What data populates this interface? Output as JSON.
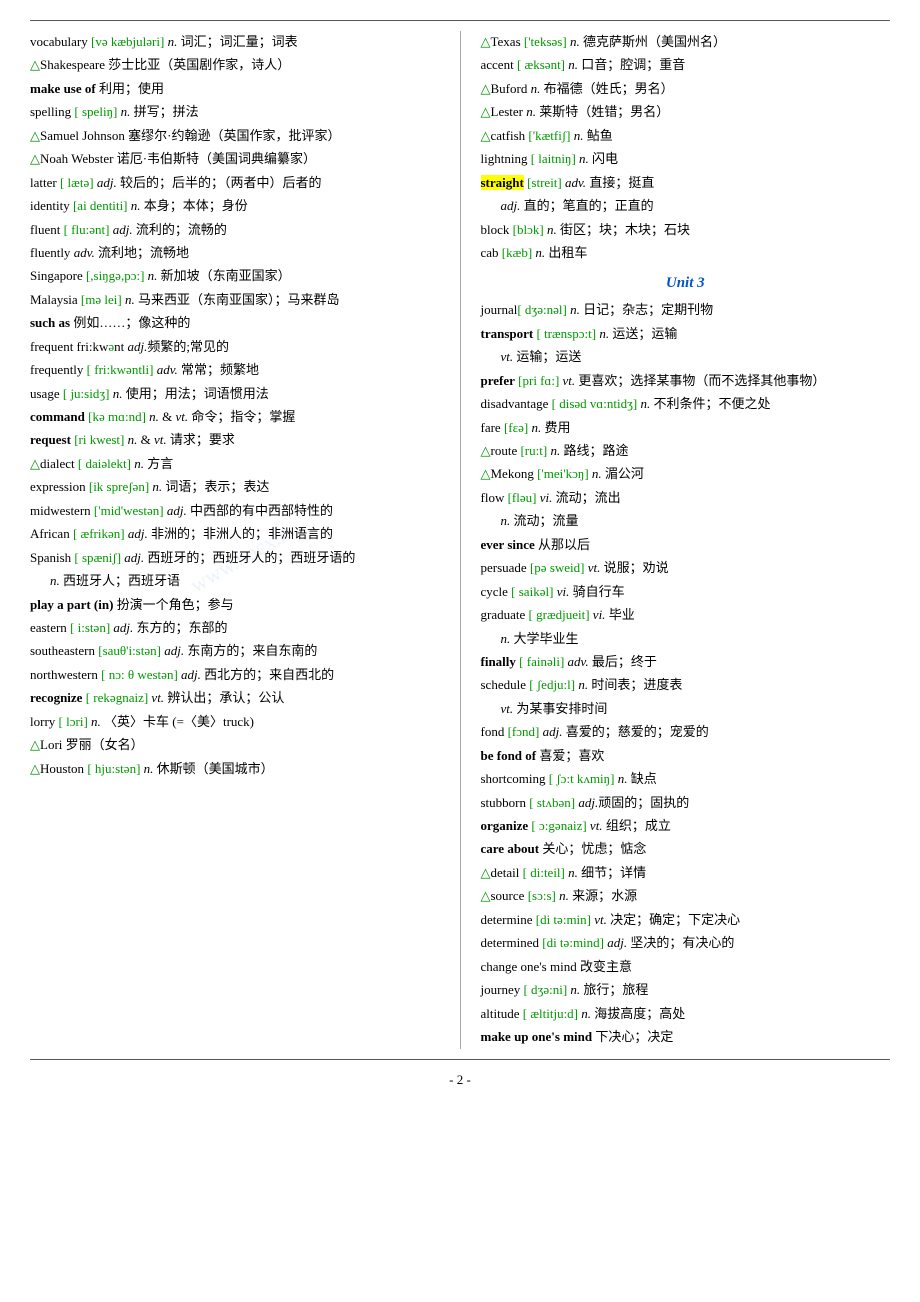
{
  "page": {
    "number": "- 2 -",
    "watermark": "www.bocx.r...",
    "divider_top": true,
    "divider_bottom": true
  },
  "left_col": [
    {
      "type": "entry",
      "text": "vocabulary [və  kæbjuləri]  <i>n.</i> 词汇；词汇量；词表",
      "indent": false
    },
    {
      "type": "entry",
      "text": "△Shakespeare 莎士比亚（英国剧作家，诗人）",
      "indent": false
    },
    {
      "type": "entry",
      "text": "<b>make use of</b> 利用；使用",
      "indent": false
    },
    {
      "type": "entry",
      "text": "spelling [  speli<span class='phonetic'>ŋ</span>]  <i>n.</i> 拼写；拼法",
      "indent": false
    },
    {
      "type": "entry",
      "text": "△Samuel Johnson 塞缪尔·约翰逊（英国作家，批评家）",
      "indent": false,
      "multiline": true
    },
    {
      "type": "entry",
      "text": "△Noah Webster 诺厄·韦伯斯特（美国词典编纂家）",
      "indent": false,
      "multiline": true
    },
    {
      "type": "entry",
      "text": "latter [  læt<span class='phonetic'>ə</span>]  <i>adj.</i> 较后的；后半的；（两者中）后者的",
      "indent": false,
      "multiline": true
    },
    {
      "type": "entry",
      "text": "identity [ai  denti<span class='phonetic'>t</span>i]  <i>n.</i> 本身；本体；身份",
      "indent": false,
      "multiline": true
    },
    {
      "type": "entry",
      "text": "fluent [  flu:<span class='phonetic'>ə</span>nt]  <i>adj.</i> 流利的；流畅的",
      "indent": false
    },
    {
      "type": "entry",
      "text": "fluently  <i>adv.</i> 流利地；流畅地",
      "indent": false
    },
    {
      "type": "entry",
      "text": "Singapore [,si<span class='phonetic'>ŋ</span>g<span class='phonetic'>ə</span>,p<span class='phonetic'>ɔ</span>:]  <i>n.</i> 新加坡（东南亚国家）",
      "indent": false,
      "multiline": true
    },
    {
      "type": "entry",
      "text": "Malaysia [m<span class='phonetic'>ə</span>  lei]  <i>n.</i> 马来西亚（东南亚国家）；马来群岛",
      "indent": false,
      "multiline": true
    },
    {
      "type": "entry",
      "text": "<b>such as</b> 例如……；像这种的",
      "indent": false
    },
    {
      "type": "entry",
      "text": "frequent   fri:kw<span class='phonetic'>ə</span>nt  <i>adj.</i>频繁的;常见的",
      "indent": false
    },
    {
      "type": "entry",
      "text": "frequently [  fri:kw<span class='phonetic'>ə</span>ntli]  <i>adv.</i> 常常；频繁地",
      "indent": false,
      "multiline": true
    },
    {
      "type": "entry",
      "text": "usage [  ju:si<span class='phonetic'>dʒ</span>]  <i>n.</i> 使用；用法；词语惯用法",
      "indent": false,
      "multiline": true
    },
    {
      "type": "entry",
      "text": "<b>command</b> [k<span class='phonetic'>ə</span>  m<span class='phonetic'>ɑ</span>:nd]  <i>n.</i> & <i>vt.</i> 命令；指令；掌握",
      "indent": false,
      "multiline": true
    },
    {
      "type": "entry",
      "text": "<b>request</b> [ri  kwest]  <i>n.</i> & <i>vt.</i> 请求；要求",
      "indent": false
    },
    {
      "type": "entry",
      "text": "△dialect [  dai<span class='phonetic'>ə</span>lekt]  <i>n.</i> 方言",
      "indent": false
    },
    {
      "type": "entry",
      "text": "expression [ik  spre<span class='phonetic'>ʃə</span>n]  <i>n.</i> 词语；表示；表达",
      "indent": false,
      "multiline": true
    },
    {
      "type": "entry",
      "text": "midwestern ['mid'west<span class='phonetic'>ə</span>n]   <i>adj.</i> 中西部的有中西部特性的",
      "indent": false,
      "multiline": true
    },
    {
      "type": "entry",
      "text": "African [  <span class='phonetic'>æ</span>frik<span class='phonetic'>ə</span>n]  <i>adj.</i> 非洲的；非洲人的；非洲语言的",
      "indent": false,
      "multiline": true
    },
    {
      "type": "entry",
      "text": "Spanish [  sp<span class='phonetic'>æ</span>ni<span class='phonetic'>ʃ</span>]  <i>adj.</i> 西班牙的；西班牙人的；西班牙语的",
      "indent": false,
      "multiline": true
    },
    {
      "type": "entry",
      "text": "         <i>n.</i> 西班牙人；西班牙语",
      "indent": true
    },
    {
      "type": "entry",
      "text": "<b>play a part (in)</b> 扮演一个角色；参与",
      "indent": false
    },
    {
      "type": "entry",
      "text": "eastern [  i:st<span class='phonetic'>ə</span>n]  <i>adj.</i> 东方的；东部的",
      "indent": false
    },
    {
      "type": "entry",
      "text": "southeastern [sauθ'i:st<span class='phonetic'>ə</span>n]  <i>adj.</i> 东南方的；来自东南的",
      "indent": false,
      "multiline": true
    },
    {
      "type": "entry",
      "text": "northwestern [  n<span class='phonetic'>ɔ</span>: θ  west<span class='phonetic'>ə</span>n]  <i>adj.</i> 西北方的；来自西北的",
      "indent": false,
      "multiline": true
    },
    {
      "type": "entry",
      "text": "<b>recognize</b> [  rek<span class='phonetic'>ə</span>gnaiz]  <i>vt.</i> 辨认出；承认；公认",
      "indent": false,
      "multiline": true
    },
    {
      "type": "entry",
      "text": "lorry [  l<span class='phonetic'>ɔ</span>ri]  <i>n.</i> 〈英〉卡车 (=〈美〉truck)",
      "indent": false
    },
    {
      "type": "entry",
      "text": "△Lori  罗丽（女名）",
      "indent": false
    },
    {
      "type": "entry",
      "text": "△Houston [  hju:st<span class='phonetic'>ə</span>n]  <i>n.</i> 休斯顿（美国城市）",
      "indent": false
    }
  ],
  "right_col": [
    {
      "type": "entry",
      "text": "△Texas ['teks<span class='phonetic'>ə</span>s]  <i>n.</i> 德克萨斯州（美国州名）",
      "indent": false,
      "multiline": true
    },
    {
      "type": "entry",
      "text": "accent [  <span class='phonetic'>æ</span>ks<span class='phonetic'>ə</span>nt]  <i>n.</i> 口音；腔调；重音",
      "indent": false
    },
    {
      "type": "entry",
      "text": "△Buford  <i>n.</i> 布福德（姓氏；男名）",
      "indent": false
    },
    {
      "type": "entry",
      "text": "△Lester  <i>n.</i> 莱斯特（姓错；男名）",
      "indent": false
    },
    {
      "type": "entry",
      "text": "△catfish ['k<span class='phonetic'>æ</span>tfi<span class='phonetic'>ʃ</span>]  <i>n.</i> 鲇鱼",
      "indent": false
    },
    {
      "type": "entry",
      "text": "lightning [  laitni<span class='phonetic'>ŋ</span>]  <i>n.</i> 闪电",
      "indent": false
    },
    {
      "type": "entry",
      "text": "<span class='highlight-yellow'>straight</span> [streit]  <i>adv.</i> 直接；挺直",
      "indent": false
    },
    {
      "type": "entry",
      "text": "        <i>adj.</i>  直的；笔直的；正直的",
      "indent": true
    },
    {
      "type": "entry",
      "text": "block [bl<span class='phonetic'>ɔ</span>k]  <i>n.</i> 街区；块；木块；石块",
      "indent": false
    },
    {
      "type": "entry",
      "text": "cab [k<span class='phonetic'>æ</span>b]  <i>n.</i> 出租车",
      "indent": false
    },
    {
      "type": "unit_title",
      "text": "Unit 3"
    },
    {
      "type": "entry",
      "text": "journal[  d<span class='phonetic'>ʒə</span>:<span class='phonetic'>nə</span>l]  <i>n.</i> 日记；杂志；定期刊物",
      "indent": false
    },
    {
      "type": "entry",
      "text": "<b>transport</b> [  tr<span class='phonetic'>æ</span>nsp<span class='phonetic'>ɔ</span>:t]  <i>n.</i> 运送；运输",
      "indent": false
    },
    {
      "type": "entry",
      "text": "              <i>vt.</i> 运输；运送",
      "indent": true
    },
    {
      "type": "entry",
      "text": "<b>prefer</b> [pri  f<span class='phonetic'>ɑ</span>:]  <i>vt.</i> 更喜欢；选择某事物（而不选择其他事物）",
      "indent": false,
      "multiline": true
    },
    {
      "type": "entry",
      "text": "disadvantage [  dis<span class='phonetic'>ə</span>d  v<span class='phonetic'>ɑ</span>:nti<span class='phonetic'>dʒ</span>]  <i>n.</i> 不利条件；不便之处",
      "indent": false,
      "multiline": true
    },
    {
      "type": "entry",
      "text": "fare [f<span class='phonetic'>ɛə</span>]  <i>n.</i> 费用",
      "indent": false
    },
    {
      "type": "entry",
      "text": "△route [ru:t]  <i>n.</i> 路线；路途",
      "indent": false
    },
    {
      "type": "entry",
      "text": "△Mekong ['mei'k<span class='phonetic'>ɔŋ</span>]  <i>n.</i> 湄公河",
      "indent": false
    },
    {
      "type": "entry",
      "text": "flow [fl<span class='phonetic'>əu</span>]  <i>vi.</i> 流动；流出",
      "indent": false
    },
    {
      "type": "entry",
      "text": "        <i>n.</i> 流动；流量",
      "indent": true
    },
    {
      "type": "entry",
      "text": "<b>ever since</b> 从那以后",
      "indent": false
    },
    {
      "type": "entry",
      "text": "persuade [p<span class='phonetic'>ə</span>  sweid]  <i>vt.</i> 说服；劝说",
      "indent": false
    },
    {
      "type": "entry",
      "text": "cycle [  saik<span class='phonetic'>ə</span>l]  <i>vi.</i> 骑自行车",
      "indent": false
    },
    {
      "type": "entry",
      "text": "graduate [  gr<span class='phonetic'>æ</span>djueit]  <i>vi.</i> 毕业",
      "indent": false
    },
    {
      "type": "entry",
      "text": "            <i>n.</i> 大学毕业生",
      "indent": true
    },
    {
      "type": "entry",
      "text": "<b>finally</b> [  fain<span class='phonetic'>ə</span>li]  <i>adv.</i> 最后；终于",
      "indent": false
    },
    {
      "type": "entry",
      "text": "schedule [  <span class='phonetic'>ʃ</span>edju:l]  <i>n.</i> 时间表；进度表",
      "indent": false
    },
    {
      "type": "entry",
      "text": "              <i>vt.</i> 为某事安排时间",
      "indent": true
    },
    {
      "type": "entry",
      "text": "fond [f<span class='phonetic'>ɔ</span>nd]  <i>adj.</i> 喜爱的；慈爱的；宠爱的",
      "indent": false
    },
    {
      "type": "entry",
      "text": "<b>be fond of</b> 喜爱；喜欢",
      "indent": false
    },
    {
      "type": "entry",
      "text": "shortcoming [  <span class='phonetic'>ʃɔ</span>:t  k<span class='phonetic'>ʌ</span>mi<span class='phonetic'>ŋ</span>]  <i>n.</i> 缺点",
      "indent": false
    },
    {
      "type": "entry",
      "text": "stubborn [  st<span class='phonetic'>ʌ</span>b<span class='phonetic'>ə</span>n]  <i>adj.</i>顽固的；固执的",
      "indent": false
    },
    {
      "type": "entry",
      "text": "<b>organize</b> [  <span class='phonetic'>ɔ</span>:g<span class='phonetic'>ə</span>naiz]  <i>vt.</i> 组织；成立",
      "indent": false
    },
    {
      "type": "entry",
      "text": "<b>care about</b> 关心；忧虑；惦念",
      "indent": false
    },
    {
      "type": "entry",
      "text": "△detail [  di:teil]  <i>n.</i> 细节；详情",
      "indent": false
    },
    {
      "type": "entry",
      "text": "△source [s<span class='phonetic'>ɔ</span>:s]  <i>n.</i> 来源；水源",
      "indent": false
    },
    {
      "type": "entry",
      "text": "determine [di  t<span class='phonetic'>ə</span>:min]  <i>vt.</i> 决定；确定；下定决心",
      "indent": false,
      "multiline": true
    },
    {
      "type": "entry",
      "text": "determined [di  t<span class='phonetic'>ə</span>:mind]  <i>adj.</i> 坚决的；有决心的",
      "indent": false,
      "multiline": true
    },
    {
      "type": "entry",
      "text": "change one's mind 改变主意",
      "indent": false
    },
    {
      "type": "entry",
      "text": "journey [  d<span class='phonetic'>ʒə</span>:ni]  <i>n.</i> 旅行；旅程",
      "indent": false
    },
    {
      "type": "entry",
      "text": "altitude [  <span class='phonetic'>æ</span>ltitju:d]  <i>n.</i> 海拔高度；高处",
      "indent": false
    },
    {
      "type": "entry",
      "text": "<b>make up one's mind</b> 下决心；决定",
      "indent": false
    }
  ]
}
